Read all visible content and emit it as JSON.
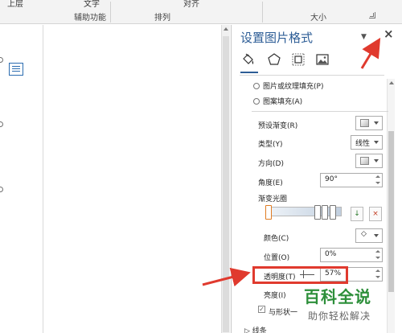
{
  "ribbon": {
    "top_left_text": "上层",
    "top_middle_text": "文字",
    "top_align_text": "对齐",
    "group_helper": "辅助功能",
    "group_arrange": "排列",
    "group_size": "大小"
  },
  "pane": {
    "title": "设置图片格式",
    "menu_glyph": "▼",
    "close_glyph": "×",
    "tabs": [
      {
        "name": "fill-line",
        "icon": "paint-bucket-icon"
      },
      {
        "name": "effects",
        "icon": "pentagon-icon"
      },
      {
        "name": "layout-properties",
        "icon": "size-icon"
      },
      {
        "name": "picture",
        "icon": "picture-icon"
      }
    ],
    "fill_options": {
      "picture_texture": "图片或纹理填充(P)",
      "pattern": "图案填充(A)"
    },
    "gradient": {
      "preset_label": "预设渐变(R)",
      "type_label": "类型(Y)",
      "type_value": "线性",
      "direction_label": "方向(D)",
      "angle_label": "角度(E)",
      "angle_value": "90°",
      "stops_label": "渐变光圈",
      "color_label": "颜色(C)",
      "position_label": "位置(O)",
      "position_value": "0%",
      "transparency_label": "透明度(T)",
      "transparency_value": "57%",
      "brightness_label": "亮度(I)",
      "rotate_label": "与形状一",
      "check_glyph": "✓"
    },
    "line_section": "线条"
  },
  "watermark": {
    "line1": "百科全说",
    "line2": "助你轻松解决"
  },
  "colors": {
    "title_blue": "#2d5d96",
    "highlight_red": "#e03a2e",
    "watermark_green": "#2d8f3a"
  }
}
